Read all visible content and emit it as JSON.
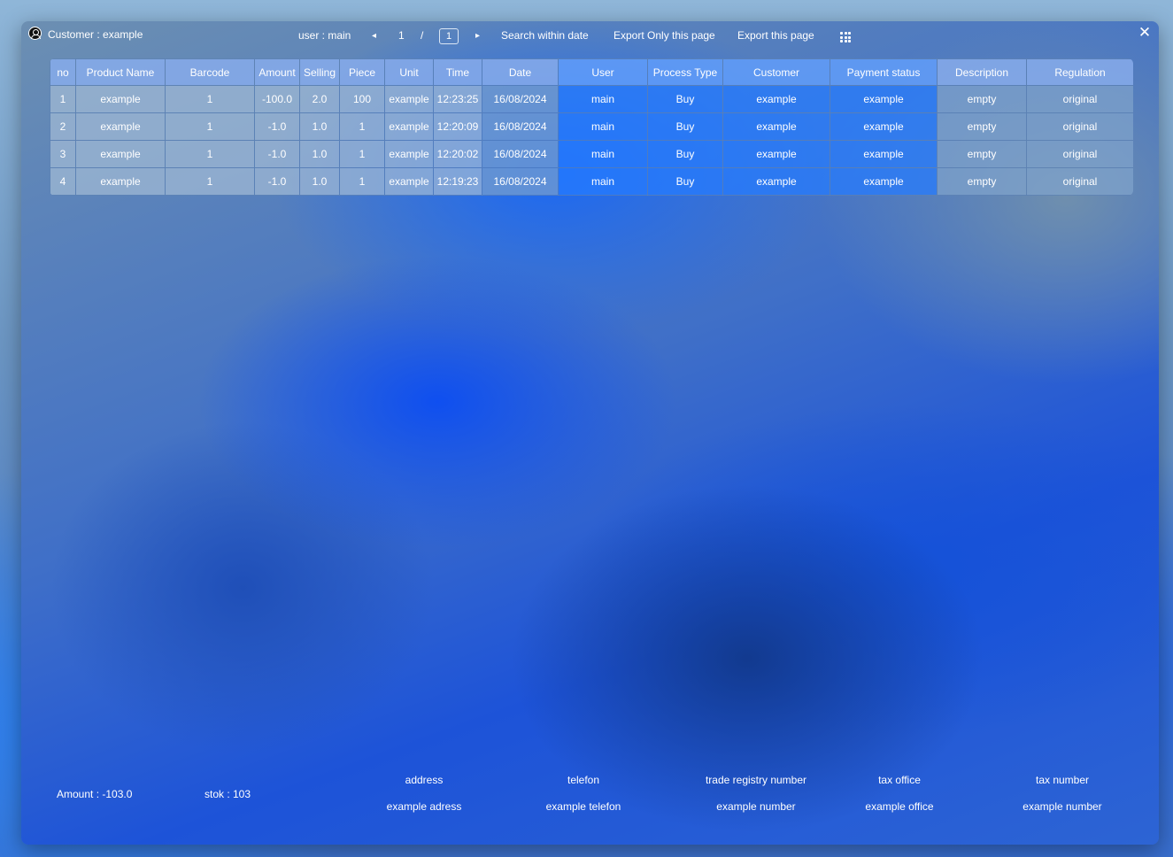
{
  "window": {
    "title": "Customer : example",
    "close_label": "✕"
  },
  "toolbar": {
    "user_label": "user : main",
    "prev_label": "◂",
    "page_current": "1",
    "page_separator": "/",
    "page_input_value": "1",
    "next_label": "▸",
    "search_label": "Search within date",
    "export_only_label": "Export Only this page",
    "export_label": "Export this page",
    "menu_icon": "grid-menu-icon"
  },
  "table": {
    "headers": [
      "no",
      "Product Name",
      "Barcode",
      "Amount",
      "Selling",
      "Piece",
      "Unit",
      "Time",
      "Date",
      "User",
      "Process Type",
      "Customer",
      "Payment status",
      "Description",
      "Regulation"
    ],
    "rows": [
      [
        "1",
        "example",
        "1",
        "-100.0",
        "2.0",
        "100",
        "example",
        "12:23:25",
        "16/08/2024",
        "main",
        "Buy",
        "example",
        "example",
        "empty",
        "original"
      ],
      [
        "2",
        "example",
        "1",
        "-1.0",
        "1.0",
        "1",
        "example",
        "12:20:09",
        "16/08/2024",
        "main",
        "Buy",
        "example",
        "example",
        "empty",
        "original"
      ],
      [
        "3",
        "example",
        "1",
        "-1.0",
        "1.0",
        "1",
        "example",
        "12:20:02",
        "16/08/2024",
        "main",
        "Buy",
        "example",
        "example",
        "empty",
        "original"
      ],
      [
        "4",
        "example",
        "1",
        "-1.0",
        "1.0",
        "1",
        "example",
        "12:19:23",
        "16/08/2024",
        "main",
        "Buy",
        "example",
        "example",
        "empty",
        "original"
      ]
    ]
  },
  "footer": {
    "amount_label": "Amount :  -103.0",
    "stok_label": "stok : 103",
    "address_label": "address",
    "address_value": "example adress",
    "telefon_label": "telefon",
    "telefon_value": "example telefon",
    "trade_label": "trade registry number",
    "trade_value": "example number",
    "tax_office_label": "tax office",
    "tax_office_value": "example office",
    "tax_number_label": "tax number",
    "tax_number_value": "example number"
  },
  "colors": {
    "header_bg": "#87abeb",
    "header_blue_bg": "#63a0ff",
    "row_bg": "#a4bcd6",
    "row_blue_bg": "#267cff",
    "text": "#ffffff"
  }
}
